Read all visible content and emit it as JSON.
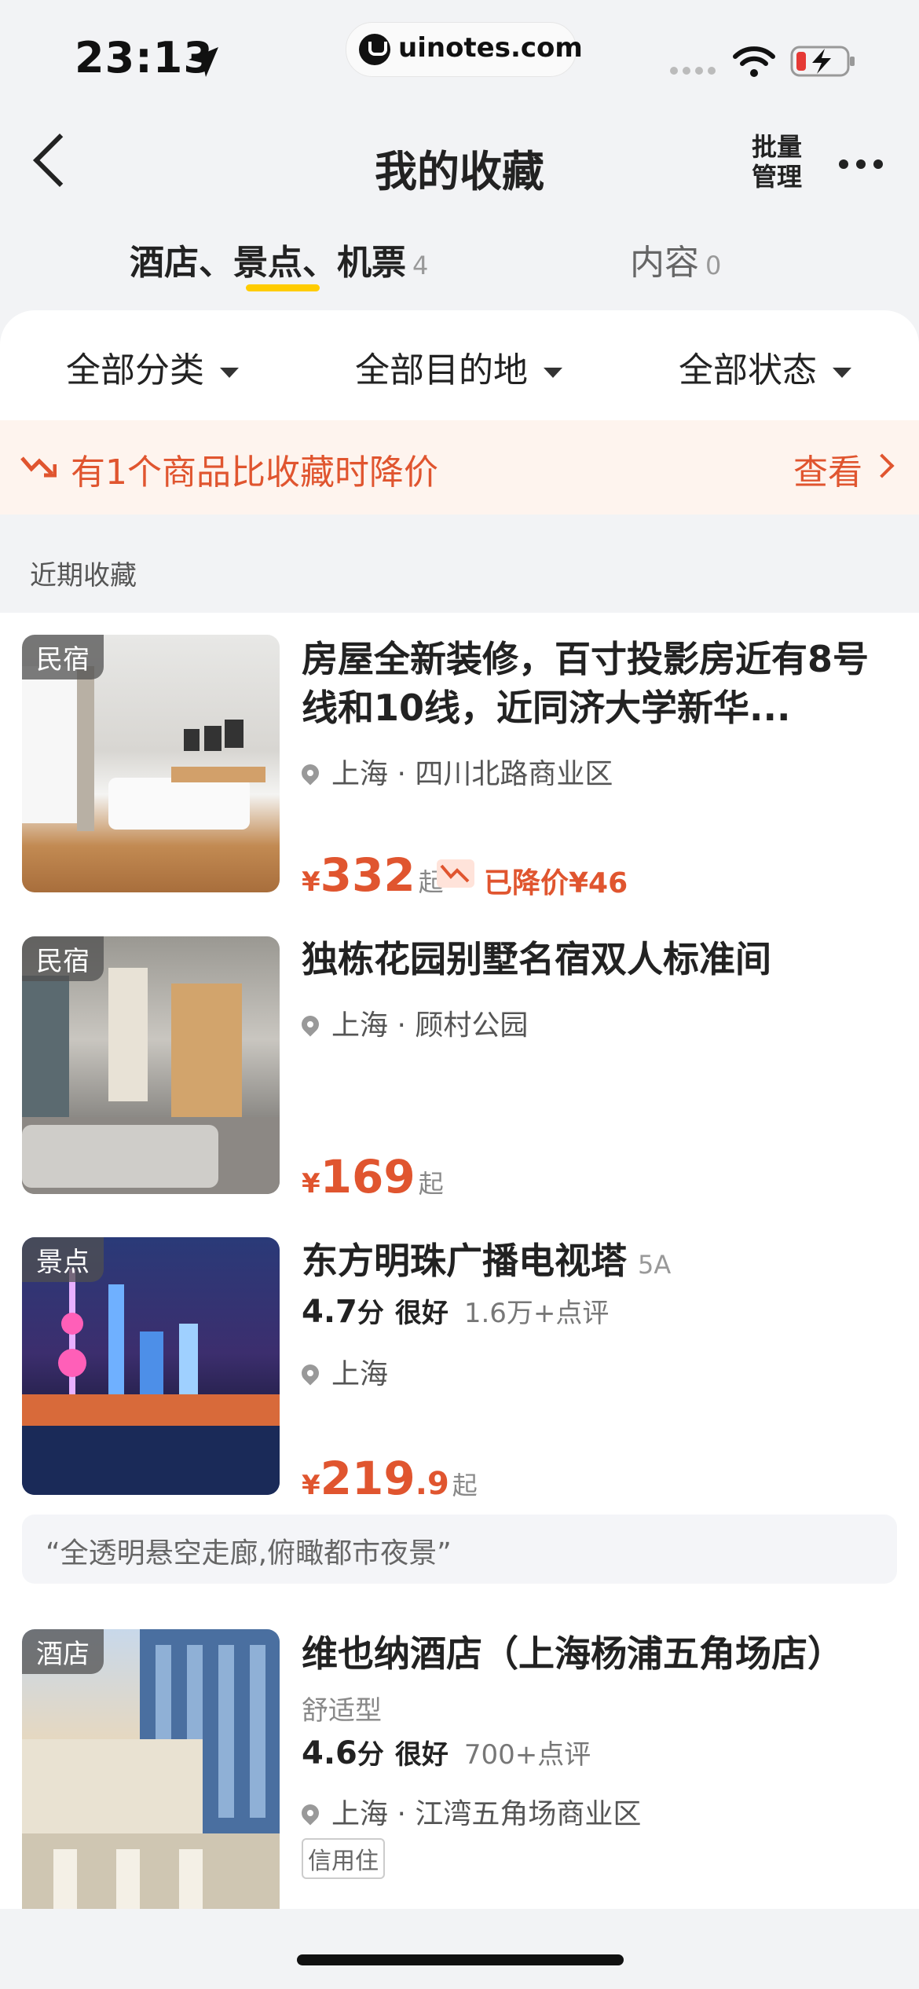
{
  "status_bar": {
    "time": "23:13",
    "url": "uinotes.com"
  },
  "header": {
    "title": "我的收藏",
    "batch_manage": "批量\n管理"
  },
  "tabs": [
    {
      "label": "酒店、景点、机票",
      "count": "4"
    },
    {
      "label": "内容",
      "count": "0"
    }
  ],
  "filters": [
    "全部分类",
    "全部目的地",
    "全部状态"
  ],
  "price_alert": {
    "message": "有1个商品比收藏时降价",
    "action": "查看"
  },
  "section_label": "近期收藏",
  "items": [
    {
      "badge": "民宿",
      "title": "房屋全新装修，百寸投影房近有8号线和10线，近同济大学新华...",
      "location": "上海 · 四川北路商业区",
      "currency": "¥",
      "price": "332",
      "price_suffix": "起",
      "price_drop": "已降价¥46"
    },
    {
      "badge": "民宿",
      "title": "独栋花园别墅名宿双人标准间",
      "location": "上海 · 顾村公园",
      "currency": "¥",
      "price": "169",
      "price_suffix": "起"
    },
    {
      "badge": "景点",
      "title": "东方明珠广播电视塔",
      "grade": "5A",
      "score": "4.7",
      "score_unit": "分",
      "score_label": "很好",
      "reviews": "1.6万+点评",
      "location": "上海",
      "currency": "¥",
      "price": "219",
      "price_decimal": ".9",
      "price_suffix": "起",
      "quote": "“全透明悬空走廊,俯瞰都市夜景”"
    },
    {
      "badge": "酒店",
      "title": "维也纳酒店（上海杨浦五角场店）",
      "category": "舒适型",
      "score": "4.6",
      "score_unit": "分",
      "score_label": "很好",
      "reviews": "700+点评",
      "location": "上海 · 江湾五角场商业区",
      "tag": "信用住"
    }
  ],
  "colors": {
    "accent": "#e0552f",
    "tab_indicator": "#ffcc00",
    "background": "#f2f3f5"
  }
}
